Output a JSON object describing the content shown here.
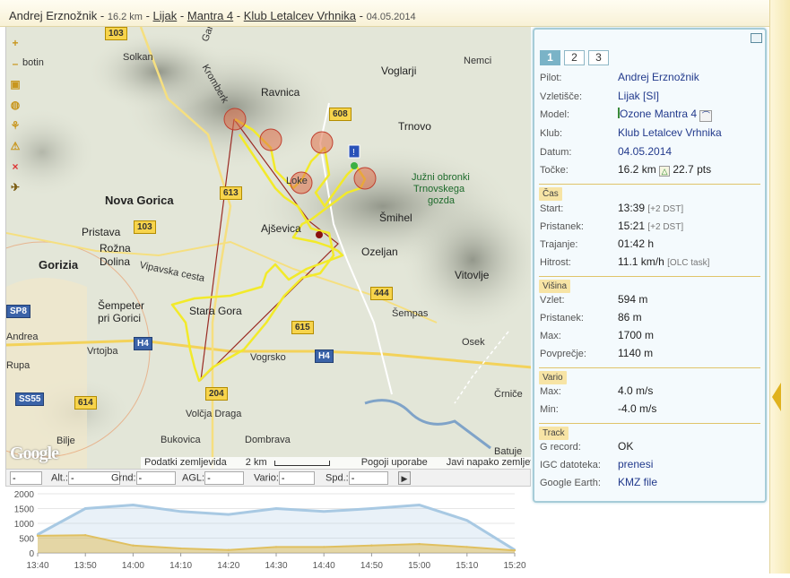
{
  "header": {
    "pilot": "Andrej Erznožnik",
    "sep1": " - ",
    "distance": "16.2 km",
    "sep2": " - ",
    "site": "Lijak",
    "sep3": " - ",
    "glider": "Mantra 4",
    "sep4": " - ",
    "club": "Klub Letalcev Vrhnika",
    "sep5": " - ",
    "date": "04.05.2014"
  },
  "colors": {
    "accent": "#7ab3c7",
    "track": "#f2ea2a",
    "section_bg": "#f7e4a5",
    "altitude_line": "#a8c9e3",
    "speed_fill": "#e0c060"
  },
  "toolbar": {
    "icons": [
      "zoom-in-icon",
      "zoom-out-icon",
      "map-layers-icon",
      "globe-icon",
      "airspace-icon",
      "warning-icon",
      "close-icon",
      "plane-icon"
    ],
    "glyphs": [
      "+",
      "–",
      "▣",
      "◍",
      "⚘",
      "⚠",
      "×",
      "✈"
    ]
  },
  "map": {
    "labels": [
      "Solkan",
      "Ravnica",
      "Voglarji",
      "Trnovo",
      "Kromberk",
      "Nova Gorica",
      "Pristava",
      "Rožna",
      "Dolina",
      "Gorizia",
      "Ajševica",
      "Šmihel",
      "Ozeljan",
      "Vitovlje",
      "Stara Gora",
      "Šempeter",
      "pri Gorici",
      "Vrtojba",
      "Šempas",
      "Osek",
      "Volčja Draga",
      "Bukovica",
      "Dombrava",
      "Črniče",
      "Batuje",
      "Bilje",
      "Južni obronki",
      "Trnovskega",
      "gozda",
      "Loke",
      "Vogrsko",
      "Vipavska cesta",
      "Andrea",
      "Rupa",
      "botin",
      "Nemci",
      "Gargaro"
    ],
    "roads": [
      "103",
      "608",
      "613",
      "103",
      "444",
      "615",
      "H4",
      "H4",
      "204",
      "614",
      "SS55",
      "SP8"
    ],
    "footer": {
      "map_data": "Podatki zemljevida",
      "scale": "2 km",
      "terms": "Pogoji uporabe",
      "report": "Javi napako zemljevida"
    },
    "brand": "Google"
  },
  "readout": {
    "alt_label": "Alt.:",
    "alt_value": "-",
    "grnd_label": "Grnd:",
    "grnd_value": "-",
    "agl_label": "AGL:",
    "agl_value": "-",
    "vario_label": "Vario:",
    "vario_value": "-",
    "spd_label": "Spd.:",
    "spd_value": "-",
    "first_value": "-"
  },
  "chart_data": {
    "type": "area",
    "x": [
      "13:40",
      "13:50",
      "14:00",
      "14:10",
      "14:20",
      "14:30",
      "14:40",
      "14:50",
      "15:00",
      "15:10",
      "15:20"
    ],
    "ylim": [
      0,
      2000
    ],
    "yticks": [
      "2000",
      "1500",
      "1000",
      "500",
      "0"
    ],
    "series": [
      {
        "values": [
          620,
          1500,
          1620,
          1400,
          1300,
          1500,
          1400,
          1500,
          1620,
          1100,
          100
        ]
      },
      {
        "values": [
          580,
          600,
          250,
          150,
          100,
          200,
          200,
          250,
          300,
          200,
          86
        ]
      }
    ]
  },
  "panel": {
    "tabs": [
      "1",
      "2",
      "3"
    ],
    "rows_general": [
      {
        "k": "Pilot:",
        "v": "Andrej Erznožnik"
      },
      {
        "k": "Vzletišče:",
        "v": "Lijak [SI]"
      },
      {
        "k": "Model:",
        "v": "Ozone Mantra 4"
      },
      {
        "k": "Klub:",
        "v": "Klub Letalcev Vrhnika"
      },
      {
        "k": "Datum:",
        "v": "04.05.2014"
      }
    ],
    "points": {
      "k": "Točke:",
      "dist": "16.2 km",
      "pts": "22.7 pts"
    },
    "time_title": "Čas",
    "time": {
      "start_k": "Start:",
      "start_v": "13:39",
      "start_note": "[+2 DST]",
      "land_k": "Pristanek:",
      "land_v": "15:21",
      "land_note": "[+2 DST]",
      "dur_k": "Trajanje:",
      "dur_v": "01:42 h",
      "speed_k": "Hitrost:",
      "speed_v": "11.1 km/h",
      "speed_note": "[OLC task]"
    },
    "height_title": "Višina",
    "height": [
      {
        "k": "Vzlet:",
        "v": "594 m"
      },
      {
        "k": "Pristanek:",
        "v": "86 m"
      },
      {
        "k": "Max:",
        "v": "1700 m"
      },
      {
        "k": "Povprečje:",
        "v": "1140 m"
      }
    ],
    "vario_title": "Vario",
    "vario": [
      {
        "k": "Max:",
        "v": "4.0 m/s"
      },
      {
        "k": "Min:",
        "v": "-4.0 m/s"
      }
    ],
    "track_title": "Track",
    "track": [
      {
        "k": "G record:",
        "v": "OK"
      },
      {
        "k": "IGC datoteka:",
        "v": "prenesi"
      },
      {
        "k": "Google Earth:",
        "v": "KMZ file"
      }
    ]
  }
}
